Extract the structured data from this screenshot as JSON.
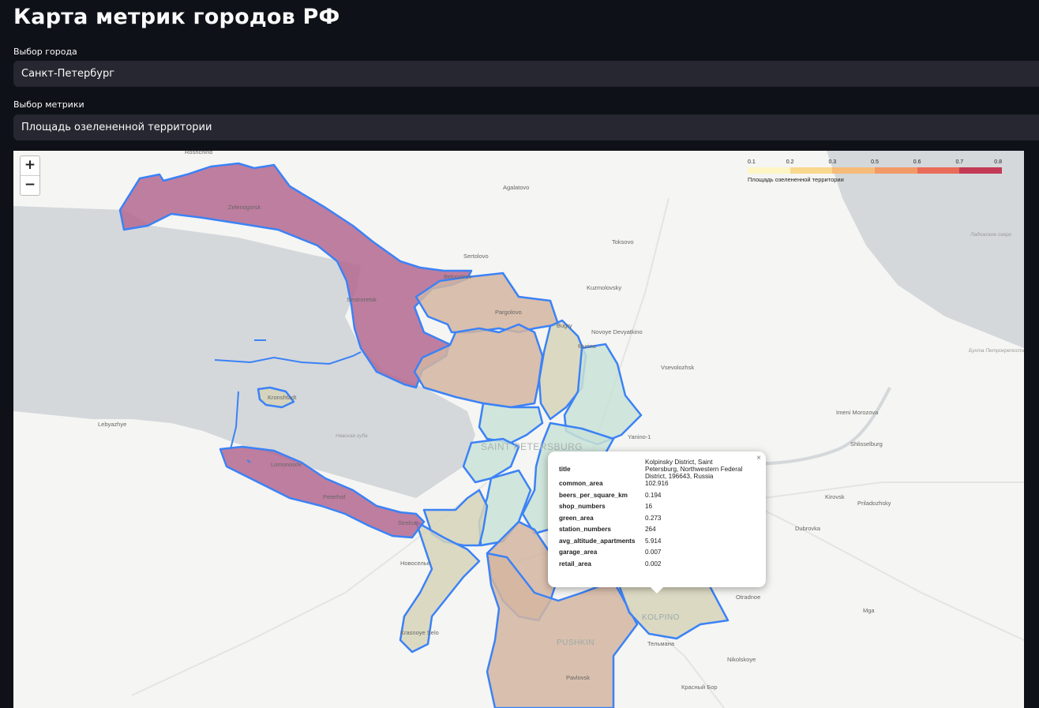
{
  "page": {
    "title": "Карта метрик городов РФ"
  },
  "city_select": {
    "label": "Выбор города",
    "value": "Санкт-Петербург"
  },
  "metric_select": {
    "label": "Выбор метрики",
    "value": "Площадь озелененной территории"
  },
  "map": {
    "zoom_in": "+",
    "zoom_out": "−",
    "legend": {
      "ticks": [
        "0.1",
        "0.2",
        "0.3",
        "0.5",
        "0.6",
        "0.7",
        "0.8"
      ],
      "colors": [
        "#fdf6c4",
        "#f9d88e",
        "#f6bb78",
        "#f29a67",
        "#e86c58",
        "#c23a55"
      ],
      "caption": "Площадь озелененной территории"
    },
    "place_labels": [
      "Roshchino",
      "Zelenogorsk",
      "Agalatovo",
      "Sertolovo",
      "Toksovo",
      "Ладожское озеро",
      "Kuzmolovsky",
      "Beloostrov",
      "Sestroretsk",
      "Pargolovo",
      "Bugry",
      "Novoye Devyatkino",
      "Murino",
      "Vsevolozhsk",
      "Бухта Петрокрепость",
      "Kronshtadt",
      "Lebyazhye",
      "Невская губа",
      "Imeni Morozova",
      "Yanino-1",
      "SAINT PETERSBURG",
      "Shlisselburg",
      "Lomonosov",
      "Peterhof",
      "Strelna",
      "Kirovsk",
      "Priladozhsky",
      "Dubrovka",
      "Новоселье",
      "Otradnoe",
      "Mga",
      "KOLPINO",
      "PUSHKIN",
      "Krasnoye Selo",
      "Тельмана",
      "Nikolskoye",
      "Pavlovsk",
      "Красный Бор"
    ],
    "popup": {
      "close": "×",
      "rows": [
        {
          "key": "title",
          "value": "Kolpinsky District, Saint Petersburg, Northwestern Federal District, 196643, Russia"
        },
        {
          "key": "common_area",
          "value": "102.916"
        },
        {
          "key": "beers_per_square_km",
          "value": "0.194"
        },
        {
          "key": "shop_numbers",
          "value": "16"
        },
        {
          "key": "green_area",
          "value": "0.273"
        },
        {
          "key": "station_numbers",
          "value": "264"
        },
        {
          "key": "avg_altitude_apartments",
          "value": "5.914"
        },
        {
          "key": "garage_area",
          "value": "0.007"
        },
        {
          "key": "retail_area",
          "value": "0.002"
        }
      ]
    },
    "colors": {
      "water": "#d4d8db",
      "land": "#f5f5f3",
      "boundary": "#3b82f6",
      "high": "#b4688f",
      "mid": "#d3b5a0",
      "light": "#c9e2d6",
      "olive": "#d6d4b8"
    }
  }
}
